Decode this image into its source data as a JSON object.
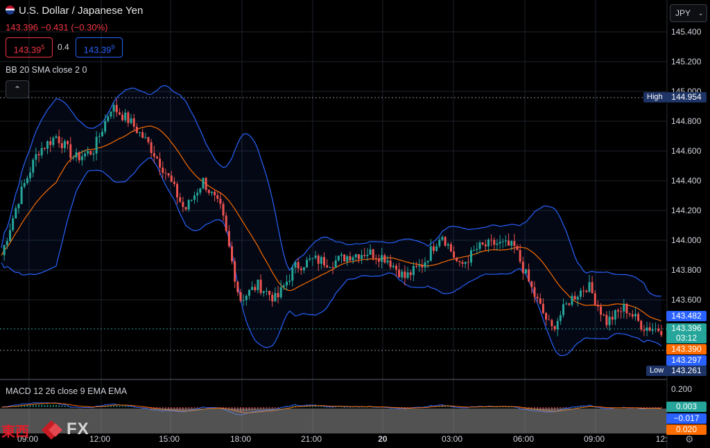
{
  "symbol": {
    "title": "U.S. Dollar / Japanese Yen"
  },
  "quote": {
    "last": "143.396",
    "change": "−0.431",
    "change_pct": "(−0.30%)"
  },
  "bid": {
    "main": "143.39",
    "sup": "5"
  },
  "ask": {
    "main": "143.39",
    "sup": "9"
  },
  "spread": "0.4",
  "indicator_bb": "BB 20 SMA close 2 0",
  "indicator_macd": "MACD 12 26 close 9 EMA EMA",
  "currency": "JPY",
  "collapse_icon": "chevron-up-icon",
  "settings_icon": "gear-icon",
  "price_axis": [
    "145.400",
    "145.200",
    "145.000",
    "144.800",
    "144.600",
    "144.400",
    "144.200",
    "144.000",
    "143.800",
    "143.600"
  ],
  "macd_axis": {
    "top": "0.200",
    "macd": "0.003",
    "signal": "−0.017",
    "hist": "0.020"
  },
  "price_tags": {
    "upper": "143.482",
    "last": "143.396",
    "countdown": "03:12",
    "basis": "143.390",
    "lower": "143.297",
    "high_label": "High",
    "high_value": "144.954",
    "low_label": "Low",
    "low_value": "143.261"
  },
  "time_axis": [
    "09:00",
    "12:00",
    "15:00",
    "18:00",
    "21:00",
    "20",
    "03:00",
    "06:00",
    "09:00",
    "12:"
  ],
  "logo": {
    "cn": "東西",
    "fx": "FX"
  },
  "colors": {
    "up": "#26a69a",
    "down": "#ef5350",
    "bb": "#2962ff",
    "basis": "#ff6d00",
    "macd": "#2962ff",
    "signal": "#ff6d00"
  },
  "chart_data": {
    "type": "candlestick",
    "series_price_approx": [
      143.9,
      144.3,
      144.6,
      144.7,
      144.55,
      144.6,
      144.9,
      144.8,
      144.65,
      144.45,
      144.2,
      144.4,
      144.2,
      143.6,
      143.7,
      143.6,
      143.82,
      143.87,
      143.85,
      143.9,
      143.92,
      143.88,
      143.75,
      143.84,
      144.05,
      143.82,
      143.95,
      143.98,
      143.95,
      143.65,
      143.4,
      143.6,
      143.7,
      143.45,
      143.55,
      143.42,
      143.4
    ],
    "ylim": [
      143.261,
      145.4
    ]
  }
}
